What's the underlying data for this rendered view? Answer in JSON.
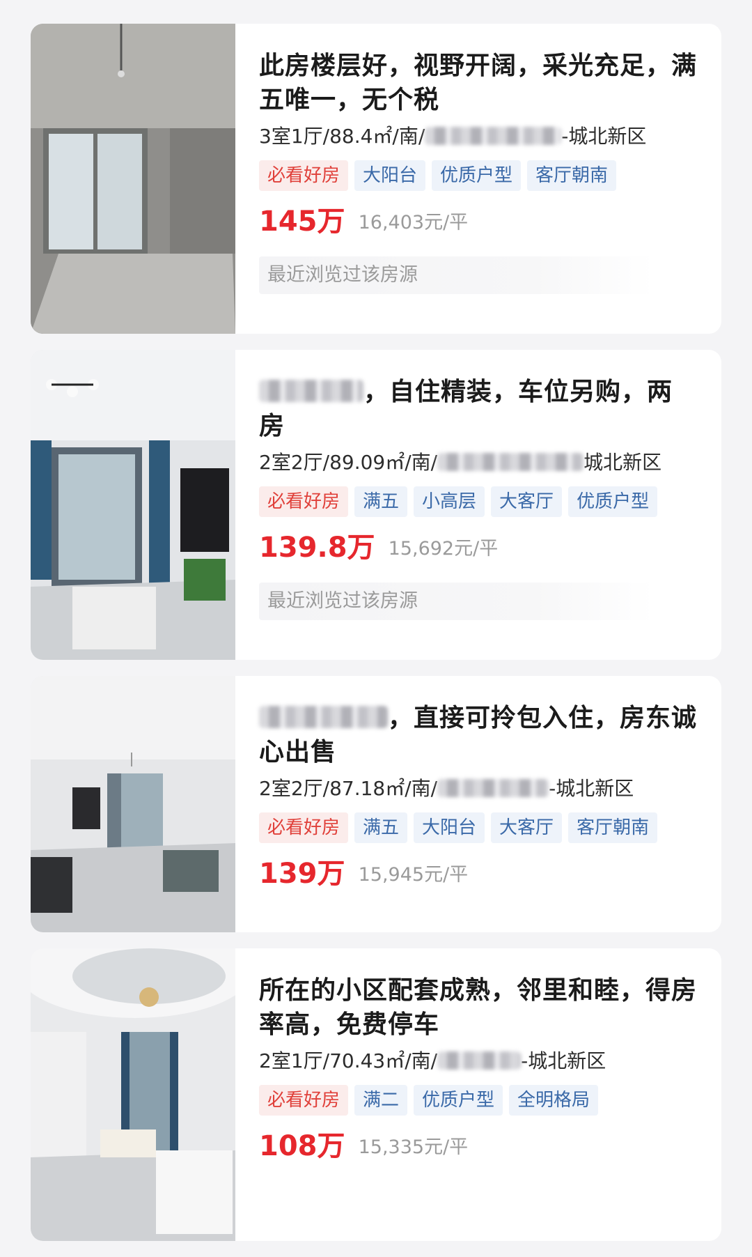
{
  "listings": [
    {
      "title": "此房楼层好，视野开阔，采光充足，满五唯一，无个税",
      "title_redacted": false,
      "meta_prefix": "3室1厅/88.4㎡/南/",
      "meta_suffix": "-城北新区",
      "tags": [
        "必看好房",
        "大阳台",
        "优质户型",
        "客厅朝南"
      ],
      "price": "145万",
      "unit_price": "16,403元/平",
      "recent": "最近浏览过该房源"
    },
    {
      "title": "，自住精装，车位另购，两房",
      "title_redacted": true,
      "meta_prefix": "2室2厅/89.09㎡/南/",
      "meta_suffix": "城北新区",
      "tags": [
        "必看好房",
        "满五",
        "小高层",
        "大客厅",
        "优质户型"
      ],
      "price": "139.8万",
      "unit_price": "15,692元/平",
      "recent": "最近浏览过该房源"
    },
    {
      "title": "，直接可拎包入住，房东诚心出售",
      "title_redacted": true,
      "meta_prefix": "2室2厅/87.18㎡/南/",
      "meta_suffix": "-城北新区",
      "tags": [
        "必看好房",
        "满五",
        "大阳台",
        "大客厅",
        "客厅朝南"
      ],
      "price": "139万",
      "unit_price": "15,945元/平",
      "recent": ""
    },
    {
      "title": "所在的小区配套成熟，邻里和睦，得房率高，免费停车",
      "title_redacted": false,
      "meta_prefix": "2室1厅/70.43㎡/南/",
      "meta_suffix": "-城北新区",
      "tags": [
        "必看好房",
        "满二",
        "优质户型",
        "全明格局"
      ],
      "price": "108万",
      "unit_price": "15,335元/平",
      "recent": ""
    }
  ],
  "colors": {
    "price": "#e6272d",
    "tag_text": "#3a69a8",
    "tag_bg": "#eef3fa",
    "highlight_tag_text": "#e0403a",
    "highlight_tag_bg": "#fbeceb"
  }
}
